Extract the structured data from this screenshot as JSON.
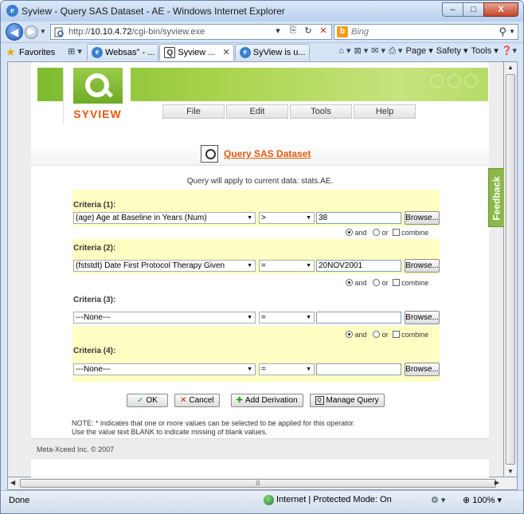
{
  "window": {
    "title": "Syview - Query SAS Dataset - AE - Windows Internet Explorer",
    "buttons": {
      "minimize": "–",
      "maximize": "□",
      "close": "X"
    }
  },
  "address": {
    "url_prefix": "http://",
    "url_host": "10.10.4.72",
    "url_path": "/cgi-bin/syview.exe",
    "search_placeholder": "Bing"
  },
  "favorites": {
    "label": "Favorites",
    "tabs": [
      {
        "label": "Websas\" - ..."
      },
      {
        "label": "Syview ...",
        "active": true
      },
      {
        "label": "SyView is u..."
      }
    ],
    "commands": [
      "Page ▾",
      "Safety ▾",
      "Tools ▾"
    ]
  },
  "app": {
    "logo_text": "SYVIEW",
    "menu": [
      "File",
      "Edit",
      "Tools",
      "Help"
    ],
    "page_title": "Query SAS Dataset",
    "intro_note": "Query will apply to current data: stats.AE.",
    "browse_label": "Browse...",
    "logic": {
      "and": "and",
      "or": "or",
      "combine": "combine"
    },
    "criteria": [
      {
        "label": "Criteria (1):",
        "variable": "(age) Age at Baseline in Years (Num)",
        "operator": ">",
        "value": "38"
      },
      {
        "label": "Criteria (2):",
        "variable": "(fststdt) Date First Protocol Therapy Given",
        "operator": "=",
        "value": "20NOV2001"
      },
      {
        "label": "Criteria (3):",
        "variable": "---None---",
        "operator": "=",
        "value": ""
      },
      {
        "label": "Criteria (4):",
        "variable": "---None---",
        "operator": "=",
        "value": ""
      }
    ],
    "actions": {
      "ok": "OK",
      "cancel": "Cancel",
      "add_derivation": "Add Derivation",
      "manage_query": "Manage Query"
    },
    "note_line1": "NOTE: * indicates that one or more values can be selected to be applied for this operator.",
    "note_line2": "Use the value text BLANK to indicate missing of blank values.",
    "footer": "Meta-Xceed Inc. © 2007",
    "feedback": "Feedback"
  },
  "status": {
    "left": "Done",
    "zone": "Internet | Protected Mode: On",
    "zoom": "100%"
  },
  "colors": {
    "accent_orange": "#e35a10",
    "banner_green": "#8cc23c",
    "criteria_bg": "#ffffc4"
  }
}
